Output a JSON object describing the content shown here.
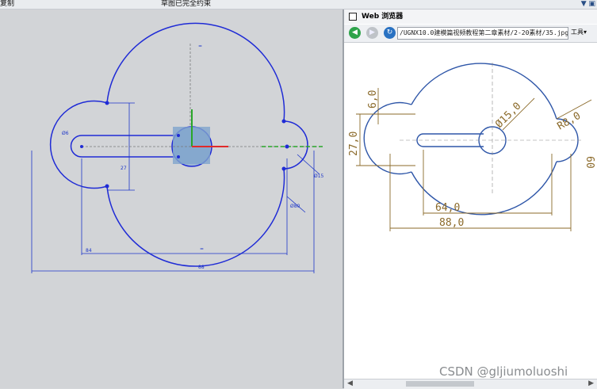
{
  "topbar": {
    "left_label": "复制",
    "center_label": "草图已完全约束"
  },
  "canvas": {
    "dims": {
      "d6": "Ø6",
      "d27": "27",
      "d15": "Ø15",
      "d80": "Ø80",
      "d84": "84",
      "d88": "88",
      "eq": "="
    }
  },
  "browser": {
    "title": "Web 浏览器",
    "url": "/UGNX10.0建模篇视频教程第二章素材/2-20素材/35.jpg",
    "tools_label": "工具",
    "drawing": {
      "d60": "6,0",
      "d270": "27,0",
      "d150": "Ø15,0",
      "r80": "R8,0",
      "d640": "64,0",
      "d880": "88,0",
      "d60r": "60"
    }
  },
  "watermark": "CSDN @gljiumoluoshi"
}
